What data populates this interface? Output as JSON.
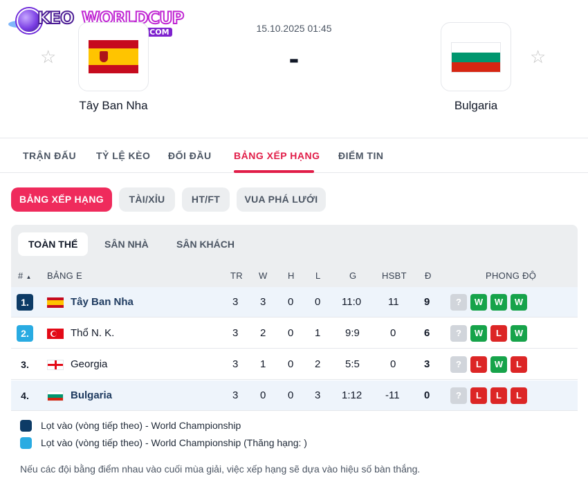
{
  "logo": {
    "part1": "KEO",
    "part2": "WORLDCUP",
    "part3": ".COM"
  },
  "match": {
    "datetime": "15.10.2025 01:45",
    "score": "-",
    "home": {
      "name": "Tây Ban Nha",
      "favorite_icon": "star-outline"
    },
    "away": {
      "name": "Bulgaria",
      "favorite_icon": "star-outline"
    }
  },
  "tabs": [
    {
      "label": "TRẬN ĐẤU"
    },
    {
      "label": "TỶ LỆ KÈO"
    },
    {
      "label": "ĐỐI ĐẦU"
    },
    {
      "label": "BẢNG XẾP HẠNG",
      "active": true
    },
    {
      "label": "ĐIỂM TIN"
    }
  ],
  "pills": [
    {
      "label": "BẢNG XẾP HẠNG",
      "active": true
    },
    {
      "label": "TÀI/XỈU"
    },
    {
      "label": "HT/FT"
    },
    {
      "label": "VUA PHÁ LƯỚI"
    }
  ],
  "subtabs": [
    {
      "label": "TOÀN THỂ",
      "active": true
    },
    {
      "label": "SÂN NHÀ"
    },
    {
      "label": "SÂN KHÁCH"
    }
  ],
  "table": {
    "headers": {
      "rank": "#",
      "group": "BẢNG E",
      "tr": "TR",
      "w": "W",
      "h": "H",
      "l": "L",
      "g": "G",
      "hsbt": "HSBT",
      "d": "Đ",
      "form": "PHONG ĐỘ"
    },
    "rows": [
      {
        "rank": "1.",
        "team": "Tây Ban Nha",
        "tr": "3",
        "w": "3",
        "h": "0",
        "l": "0",
        "g": "11:0",
        "hsbt": "11",
        "d": "9",
        "form": [
          "?",
          "W",
          "W",
          "W"
        ]
      },
      {
        "rank": "2.",
        "team": "Thổ N. K.",
        "tr": "3",
        "w": "2",
        "h": "0",
        "l": "1",
        "g": "9:9",
        "hsbt": "0",
        "d": "6",
        "form": [
          "?",
          "W",
          "L",
          "W"
        ]
      },
      {
        "rank": "3.",
        "team": "Georgia",
        "tr": "3",
        "w": "1",
        "h": "0",
        "l": "2",
        "g": "5:5",
        "hsbt": "0",
        "d": "3",
        "form": [
          "?",
          "L",
          "W",
          "L"
        ]
      },
      {
        "rank": "4.",
        "team": "Bulgaria",
        "tr": "3",
        "w": "0",
        "h": "0",
        "l": "3",
        "g": "1:12",
        "hsbt": "-11",
        "d": "0",
        "form": [
          "?",
          "L",
          "L",
          "L"
        ]
      }
    ]
  },
  "legend": [
    {
      "color": "#0d3b66",
      "text": "Lọt vào (vòng tiếp theo) - World Championship"
    },
    {
      "color": "#29abe2",
      "text": "Lọt vào (vòng tiếp theo) - World Championship (Thăng hạng: )"
    }
  ],
  "note": "Nếu các đội bằng điểm nhau vào cuối mùa giải, việc xếp hạng sẽ dựa vào hiệu số bàn thắng.",
  "colors": {
    "accent": "#e11d48",
    "pill_active": "#ef2b5c",
    "win": "#16a34a",
    "loss": "#dc2626",
    "rank_qualified": "#0d3b66",
    "rank_promoted": "#29abe2"
  }
}
